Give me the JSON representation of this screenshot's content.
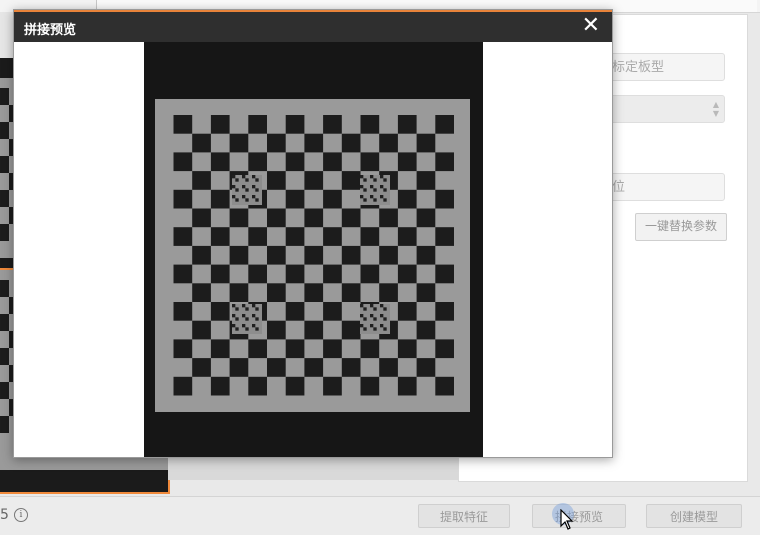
{
  "modal": {
    "title": "拼接预览",
    "close_glyph": "✕"
  },
  "right_panel": {
    "field_1_text": "标定板型",
    "field_3_text": "位",
    "replace_button": "一键替换参数"
  },
  "bottom_bar": {
    "page_text": "5",
    "info_glyph": "i",
    "extract_button": "提取特征",
    "preview_button": "拼接预览",
    "create_button": "创建模型"
  },
  "colors": {
    "accent": "#e8833a",
    "header_bg": "#2f2f2f"
  },
  "icons": {
    "close": "close-icon",
    "info": "info-icon",
    "spinner": "spinner-arrows-icon",
    "cursor": "mouse-cursor-icon"
  }
}
